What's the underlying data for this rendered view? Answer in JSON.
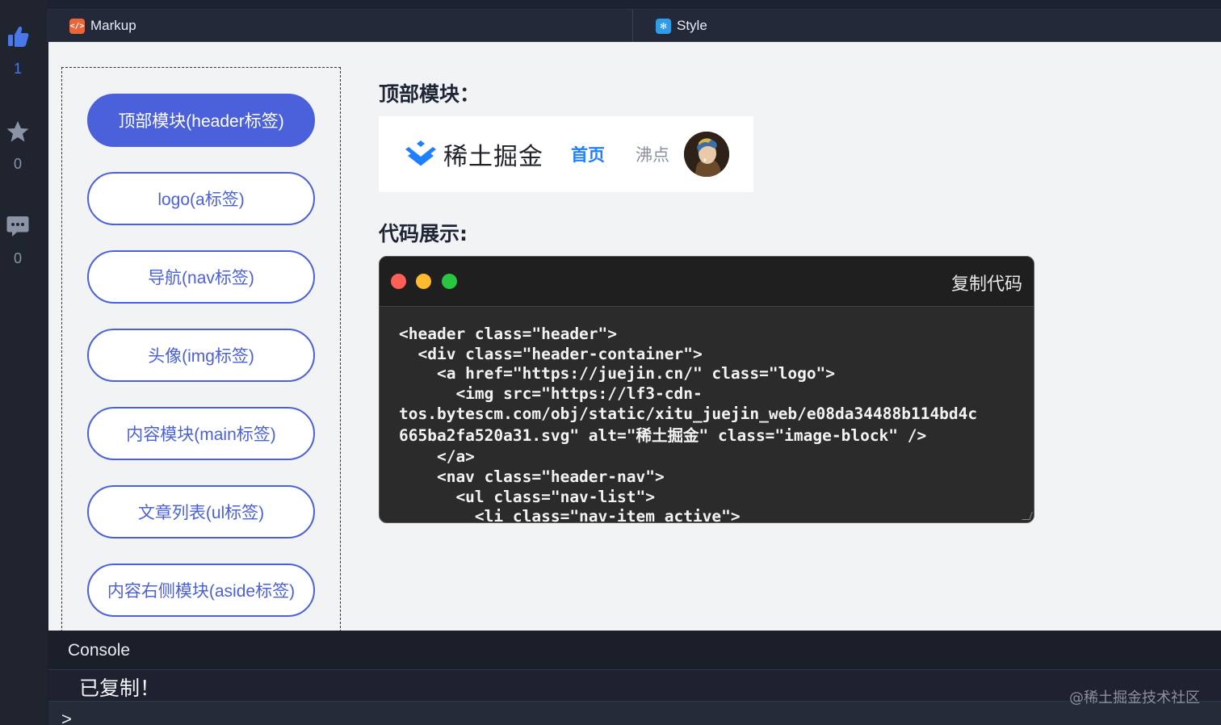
{
  "rail": {
    "like_count": "1",
    "star_count": "0",
    "comment_count": "0"
  },
  "tabs": {
    "markup": "Markup",
    "style": "Style"
  },
  "nav_pills": [
    {
      "label": "顶部模块(header标签)"
    },
    {
      "label": "logo(a标签)"
    },
    {
      "label": "导航(nav标签)"
    },
    {
      "label": "头像(img标签)"
    },
    {
      "label": "内容模块(main标签)"
    },
    {
      "label": "文章列表(ul标签)"
    },
    {
      "label": "内容右侧模块(aside标签)"
    }
  ],
  "preview": {
    "section_title": "顶部模块：",
    "logo_text": "稀土掘金",
    "nav_home": "首页",
    "nav_hot": "沸点"
  },
  "code": {
    "section_title": "代码展示:",
    "copy_label": "复制代码",
    "lines": [
      "<header class=\"header\">",
      "  <div class=\"header-container\">",
      "    <a href=\"https://juejin.cn/\" class=\"logo\">",
      "      <img src=\"https://lf3-cdn-",
      "tos.bytescm.com/obj/static/xitu_juejin_web/e08da34488b114bd4c",
      "665ba2fa520a31.svg\" alt=\"稀土掘金\" class=\"image-block\" />",
      "    </a>",
      "    <nav class=\"header-nav\">",
      "      <ul class=\"nav-list\">",
      "        <li class=\"nav-item active\">"
    ]
  },
  "console": {
    "title": "Console",
    "message": "已复制！",
    "prompt": ">"
  },
  "watermark": "@稀土掘金技术社区",
  "colors": {
    "accent": "#4b60db",
    "juejin_blue": "#1e80ff"
  }
}
